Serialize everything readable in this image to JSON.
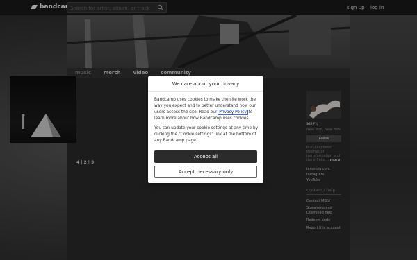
{
  "header": {
    "logo_text": "bandcamp",
    "search_placeholder": "Search for artist, album, or track",
    "signup_label": "sign up",
    "login_label": "log in"
  },
  "nav": {
    "items": [
      {
        "label": "music",
        "active": true
      },
      {
        "label": "merch",
        "active": false
      },
      {
        "label": "video",
        "active": false
      },
      {
        "label": "community",
        "active": false
      }
    ]
  },
  "discography": {
    "pages": "4 | 2 | 3"
  },
  "artist": {
    "name": "MIZU",
    "location": "New York, New York",
    "follow_label": "Follow",
    "bio": "MIZU explores themes of transformation and the infinite…",
    "more_label": "more",
    "links": [
      "iammizu.com",
      "Instagram",
      "YouTube"
    ]
  },
  "contact": {
    "heading": "contact / help",
    "links": [
      "Contact MIZU",
      "Streaming and Download help",
      "Redeem code",
      "Report this account"
    ]
  },
  "cookie_modal": {
    "title": "We care about your privacy",
    "p1_before": "Bandcamp uses cookies to make the site work the way you expect and to better understand how our users access the site. Read our ",
    "privacy_link": "Privacy Policy",
    "p1_after": " to learn more about how Bandcamp uses cookies.",
    "p2": "You can update your cookie settings at any time by clicking the \"Cookie settings\" link at the bottom of any Bandcamp page.",
    "accept_all": "Accept all",
    "accept_necessary": "Accept necessary only"
  }
}
